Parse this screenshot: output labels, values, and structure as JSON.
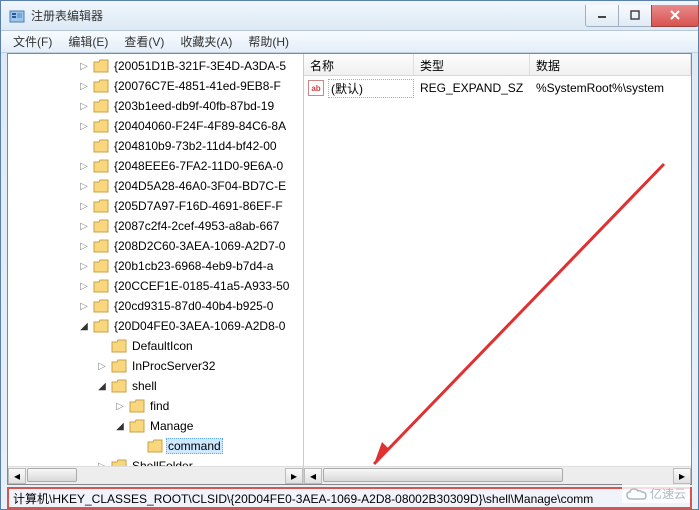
{
  "window": {
    "title": "注册表编辑器"
  },
  "menu": {
    "file": "文件(F)",
    "edit": "编辑(E)",
    "view": "查看(V)",
    "favorites": "收藏夹(A)",
    "help": "帮助(H)"
  },
  "tree": {
    "items": [
      "{20051D1B-321F-3E4D-A3DA-5",
      "{20076C7E-4851-41ed-9EB8-F",
      "{203b1eed-db9f-40fb-87bd-19",
      "{20404060-F24F-4F89-84C6-8A",
      "{204810b9-73b2-11d4-bf42-00",
      "{2048EEE6-7FA2-11D0-9E6A-0",
      "{204D5A28-46A0-3F04-BD7C-E",
      "{205D7A97-F16D-4691-86EF-F",
      "{2087c2f4-2cef-4953-a8ab-667",
      "{208D2C60-3AEA-1069-A2D7-0",
      "{20b1cb23-6968-4eb9-b7d4-a",
      "{20CCEF1E-0185-41a5-A933-50",
      "{20cd9315-87d0-40b4-b925-0",
      "{20D04FE0-3AEA-1069-A2D8-0"
    ],
    "children": {
      "defaulticon": "DefaultIcon",
      "inprocserver": "InProcServer32",
      "shell": "shell",
      "find": "find",
      "manage": "Manage",
      "command": "command",
      "shellfolder": "ShellFolder"
    }
  },
  "list": {
    "headers": {
      "name": "名称",
      "type": "类型",
      "data": "数据"
    },
    "row": {
      "name": "(默认)",
      "type": "REG_EXPAND_SZ",
      "data": "%SystemRoot%\\system"
    }
  },
  "status": {
    "path": "计算机\\HKEY_CLASSES_ROOT\\CLSID\\{20D04FE0-3AEA-1069-A2D8-08002B30309D}\\shell\\Manage\\comm"
  },
  "watermark": {
    "text": "亿速云"
  }
}
